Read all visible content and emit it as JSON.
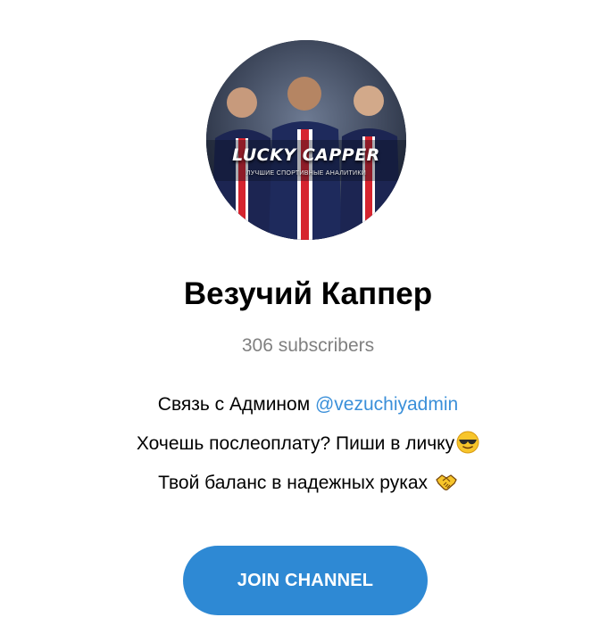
{
  "channel": {
    "avatar": {
      "logo_text": "LUCKY CAPPER",
      "logo_subtext": "ЛУЧШИЕ СПОРТИВНЫЕ АНАЛИТИКИ"
    },
    "title": "Везучий Каппер",
    "subscribers": "306 subscribers",
    "description": {
      "line1_text": "Связь с Админом ",
      "line1_mention": "@vezuchiyadmin",
      "line2_text": "Хочешь послеоплату? Пиши в личку",
      "line2_emoji": "sunglasses-emoji",
      "line3_text": "Твой баланс в надежных руках ",
      "line3_emoji": "handshake-emoji"
    },
    "join_label": "JOIN CHANNEL"
  },
  "colors": {
    "accent": "#2e89d4",
    "mention": "#3a8fd9",
    "muted": "#808080"
  }
}
